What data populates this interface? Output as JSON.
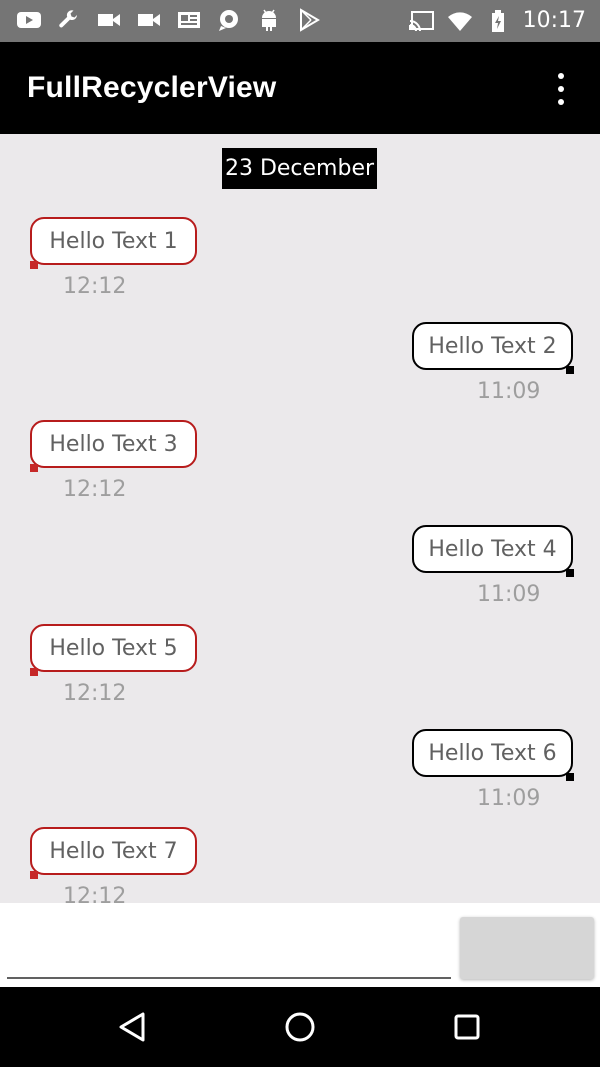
{
  "status_bar": {
    "time": "10:17",
    "left_icons": [
      "youtube-icon",
      "wrench-icon",
      "video-icon",
      "video-icon",
      "news-icon",
      "chat-icon",
      "android-icon",
      "play-store-icon"
    ],
    "right_icons": [
      "cast-icon",
      "wifi-icon",
      "battery-icon"
    ]
  },
  "app_bar": {
    "title": "FullRecyclerView",
    "menu_icon": "overflow-menu-icon"
  },
  "chat": {
    "date_header": "23 December",
    "messages": [
      {
        "text": "Hello Text 1",
        "time": "12:12",
        "direction": "incoming"
      },
      {
        "text": "Hello Text 2",
        "time": "11:09",
        "direction": "outgoing"
      },
      {
        "text": "Hello Text 3",
        "time": "12:12",
        "direction": "incoming"
      },
      {
        "text": "Hello Text 4",
        "time": "11:09",
        "direction": "outgoing"
      },
      {
        "text": "Hello Text 5",
        "time": "12:12",
        "direction": "incoming"
      },
      {
        "text": "Hello Text 6",
        "time": "11:09",
        "direction": "outgoing"
      },
      {
        "text": "Hello Text 7",
        "time": "12:12",
        "direction": "incoming"
      }
    ]
  },
  "input": {
    "value": "",
    "placeholder": "",
    "send_label": ""
  },
  "nav_bar": {
    "icons": [
      "back-icon",
      "home-icon",
      "recents-icon"
    ]
  },
  "colors": {
    "incoming_border": "#b71c1c",
    "outgoing_border": "#000000",
    "chat_background": "#ebe9eb",
    "app_bar": "#000000"
  }
}
